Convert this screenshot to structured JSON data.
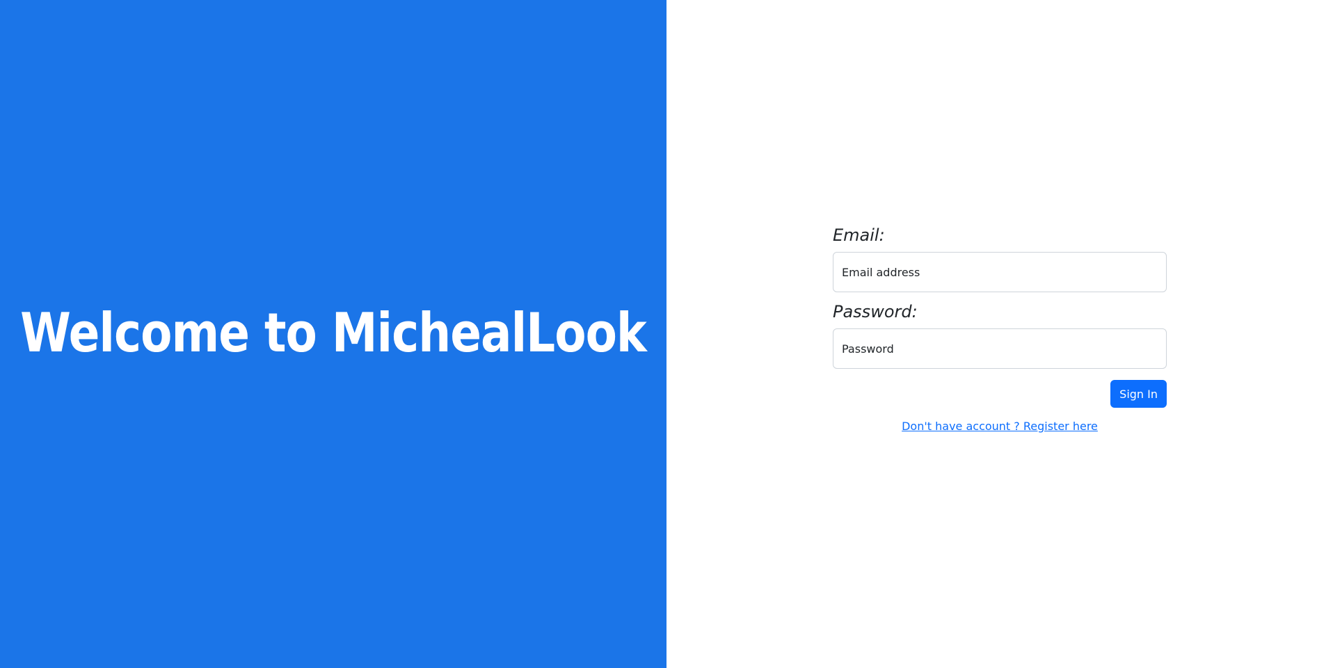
{
  "colors": {
    "hero_background": "#1b75e8",
    "hero_text": "#ffffff",
    "primary": "#0d6efd",
    "input_border": "#ced4da",
    "text": "#212529"
  },
  "hero": {
    "title": "Welcome to MichealLook"
  },
  "login_form": {
    "email_label": "Email:",
    "email_placeholder": "Email address",
    "email_value": "",
    "password_label": "Password:",
    "password_placeholder": "Password",
    "password_value": "",
    "signin_label": "Sign In",
    "register_link_text": "Don't have account ? Register here"
  }
}
